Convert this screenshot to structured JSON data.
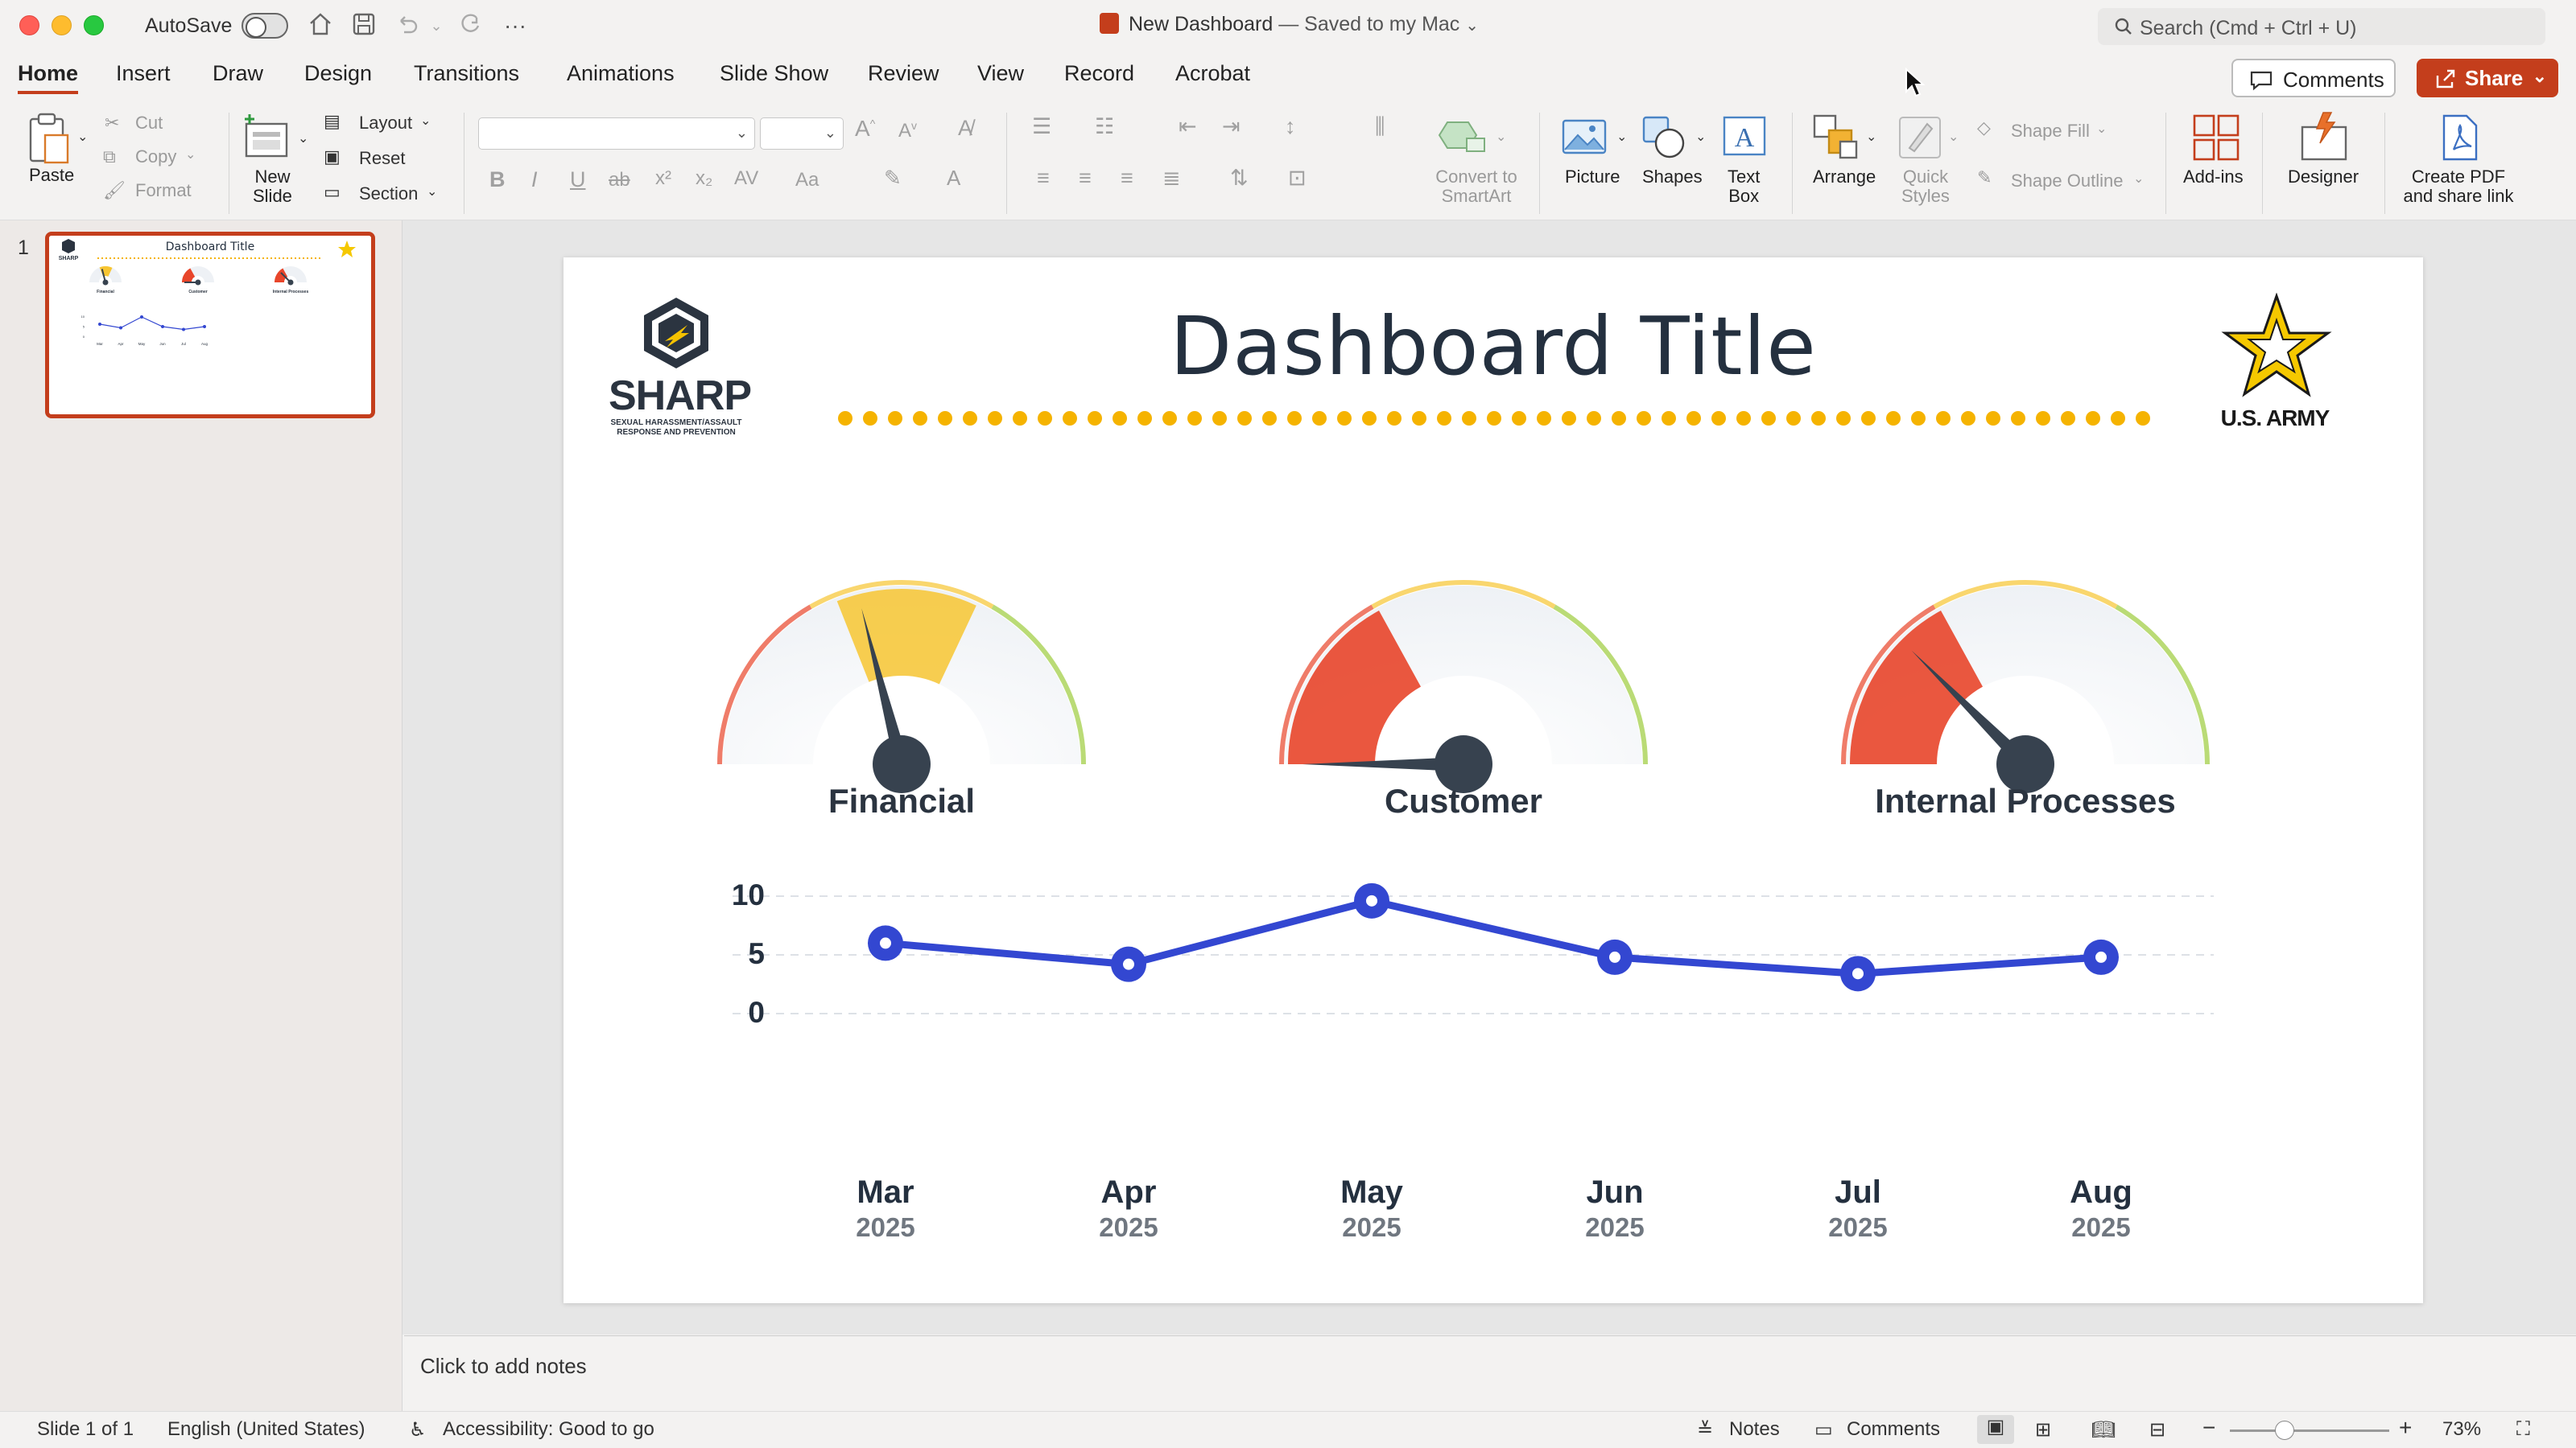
{
  "window": {
    "autosave_label": "AutoSave",
    "doc_title": "New Dashboard",
    "doc_status": "— Saved to my Mac",
    "search_placeholder": "Search (Cmd + Ctrl + U)"
  },
  "tabs": [
    "Home",
    "Insert",
    "Draw",
    "Design",
    "Transitions",
    "Animations",
    "Slide Show",
    "Review",
    "View",
    "Record",
    "Acrobat"
  ],
  "active_tab": "Home",
  "header_buttons": {
    "comments": "Comments",
    "share": "Share"
  },
  "ribbon": {
    "paste": "Paste",
    "cut": "Cut",
    "copy": "Copy",
    "format": "Format",
    "new_slide_line1": "New",
    "new_slide_line2": "Slide",
    "layout": "Layout",
    "reset": "Reset",
    "section": "Section",
    "convert_line1": "Convert to",
    "convert_line2": "SmartArt",
    "picture": "Picture",
    "shapes": "Shapes",
    "textbox_line1": "Text",
    "textbox_line2": "Box",
    "arrange": "Arrange",
    "quick_styles_line1": "Quick",
    "quick_styles_line2": "Styles",
    "shape_fill": "Shape Fill",
    "shape_outline": "Shape Outline",
    "addins": "Add-ins",
    "designer": "Designer",
    "create_pdf_line1": "Create PDF",
    "create_pdf_line2": "and share link"
  },
  "thumbnail": {
    "slide_number": "1"
  },
  "slide": {
    "title": "Dashboard Title",
    "logo_left_text": "SHARP",
    "logo_left_sub1": "SEXUAL HARASSMENT/ASSAULT",
    "logo_left_sub2": "RESPONSE AND PREVENTION",
    "logo_right_text": "U.S. ARMY",
    "gauges": [
      {
        "label": "Financial",
        "value_fraction": 0.42,
        "color": "#f7c531"
      },
      {
        "label": "Customer",
        "value_fraction": 0.0,
        "color": "#e8452a"
      },
      {
        "label": "Internal Processes",
        "value_fraction": 0.25,
        "color": "#e8452a"
      }
    ],
    "gauge_colors": {
      "low": "#e8452a",
      "mid": "#f7c531",
      "high": "#9ccc3c",
      "track": "#eef1f5",
      "needle": "#37424f"
    }
  },
  "chart_data": {
    "type": "line",
    "categories": [
      "Mar",
      "Apr",
      "May",
      "Jun",
      "Jul",
      "Aug"
    ],
    "category_years": [
      "2025",
      "2025",
      "2025",
      "2025",
      "2025",
      "2025"
    ],
    "values": [
      6,
      4.2,
      9.6,
      4.8,
      3.4,
      4.8
    ],
    "ylim": [
      0,
      10
    ],
    "yticks": [
      "0",
      "5",
      "10"
    ],
    "title": "",
    "xlabel": "",
    "ylabel": "",
    "line_color": "#3347d1",
    "grid": true
  },
  "notes_placeholder": "Click to add notes",
  "status": {
    "slide_counter": "Slide 1 of 1",
    "language": "English (United States)",
    "accessibility": "Accessibility: Good to go",
    "notes": "Notes",
    "comments": "Comments",
    "zoom": "73%"
  }
}
